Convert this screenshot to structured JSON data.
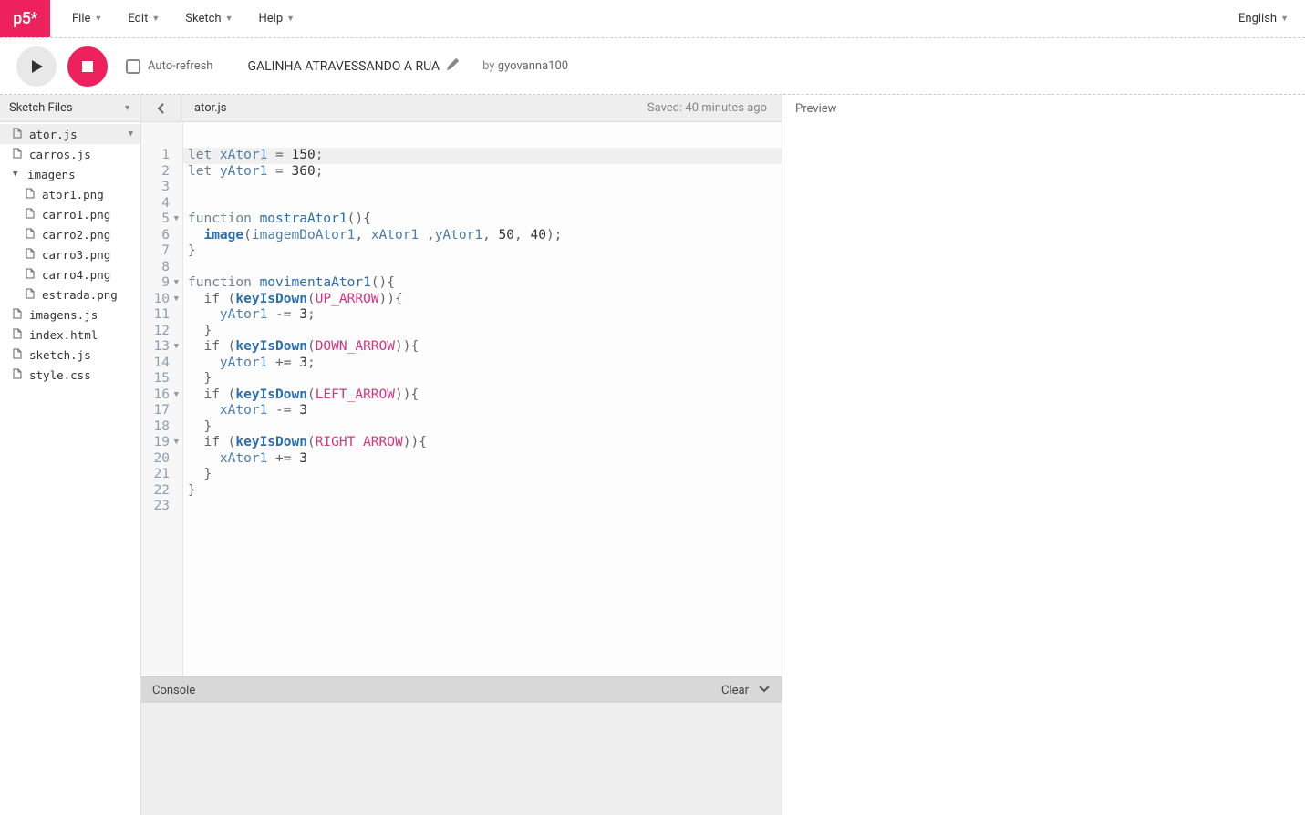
{
  "logo": "p5*",
  "menus": {
    "file": "File",
    "edit": "Edit",
    "sketch": "Sketch",
    "help": "Help"
  },
  "language": "English",
  "toolbar": {
    "autoRefresh": "Auto-refresh",
    "sketchTitle": "GALINHA ATRAVESSANDO A RUA",
    "byPrefix": "by ",
    "author": "gyovanna100"
  },
  "sidebar": {
    "header": "Sketch Files",
    "files": [
      {
        "name": "ator.js",
        "type": "file",
        "indent": 0,
        "active": true
      },
      {
        "name": "carros.js",
        "type": "file",
        "indent": 0
      },
      {
        "name": "imagens",
        "type": "folder",
        "indent": 0,
        "open": true
      },
      {
        "name": "ator1.png",
        "type": "file",
        "indent": 1
      },
      {
        "name": "carro1.png",
        "type": "file",
        "indent": 1
      },
      {
        "name": "carro2.png",
        "type": "file",
        "indent": 1
      },
      {
        "name": "carro3.png",
        "type": "file",
        "indent": 1
      },
      {
        "name": "carro4.png",
        "type": "file",
        "indent": 1
      },
      {
        "name": "estrada.png",
        "type": "file",
        "indent": 1
      },
      {
        "name": "imagens.js",
        "type": "file",
        "indent": 0
      },
      {
        "name": "index.html",
        "type": "file",
        "indent": 0
      },
      {
        "name": "sketch.js",
        "type": "file",
        "indent": 0
      },
      {
        "name": "style.css",
        "type": "file",
        "indent": 0
      }
    ]
  },
  "editor": {
    "tab": "ator.js",
    "saved": "Saved: 40 minutes ago",
    "foldLines": [
      5,
      9,
      10,
      13,
      16,
      19
    ],
    "lineCount": 23,
    "highlightedLine": 1,
    "code": [
      [
        [
          "kw2",
          "let "
        ],
        [
          "var",
          "xAtor1"
        ],
        [
          "punct",
          " = "
        ],
        [
          "num",
          "150"
        ],
        [
          "punct",
          ";"
        ]
      ],
      [
        [
          "kw2",
          "let "
        ],
        [
          "var",
          "yAtor1"
        ],
        [
          "punct",
          " = "
        ],
        [
          "num",
          "360"
        ],
        [
          "punct",
          ";"
        ]
      ],
      [],
      [],
      [
        [
          "kw2",
          "function "
        ],
        [
          "func",
          "mostraAtor1"
        ],
        [
          "punct",
          "(){"
        ]
      ],
      [
        [
          "punct",
          "  "
        ],
        [
          "image",
          "image"
        ],
        [
          "punct",
          "("
        ],
        [
          "var",
          "imagemDoAtor1"
        ],
        [
          "punct",
          ", "
        ],
        [
          "var",
          "xAtor1"
        ],
        [
          "punct",
          " ,"
        ],
        [
          "var",
          "yAtor1"
        ],
        [
          "punct",
          ", "
        ],
        [
          "num",
          "50"
        ],
        [
          "punct",
          ", "
        ],
        [
          "num",
          "40"
        ],
        [
          "punct",
          ");"
        ]
      ],
      [
        [
          "punct",
          "}"
        ]
      ],
      [],
      [
        [
          "kw2",
          "function "
        ],
        [
          "func",
          "movimentaAtor1"
        ],
        [
          "punct",
          "(){"
        ]
      ],
      [
        [
          "punct",
          "  if ("
        ],
        [
          "builtin",
          "keyIsDown"
        ],
        [
          "punct",
          "("
        ],
        [
          "const",
          "UP_ARROW"
        ],
        [
          "punct",
          ")){"
        ]
      ],
      [
        [
          "punct",
          "    "
        ],
        [
          "var",
          "yAtor1"
        ],
        [
          "punct",
          " -= "
        ],
        [
          "num",
          "3"
        ],
        [
          "punct",
          ";"
        ]
      ],
      [
        [
          "punct",
          "  }"
        ]
      ],
      [
        [
          "punct",
          "  if ("
        ],
        [
          "builtin",
          "keyIsDown"
        ],
        [
          "punct",
          "("
        ],
        [
          "const",
          "DOWN_ARROW"
        ],
        [
          "punct",
          ")){"
        ]
      ],
      [
        [
          "punct",
          "    "
        ],
        [
          "var",
          "yAtor1"
        ],
        [
          "punct",
          " += "
        ],
        [
          "num",
          "3"
        ],
        [
          "punct",
          ";"
        ]
      ],
      [
        [
          "punct",
          "  }"
        ]
      ],
      [
        [
          "punct",
          "  if ("
        ],
        [
          "builtin",
          "keyIsDown"
        ],
        [
          "punct",
          "("
        ],
        [
          "const",
          "LEFT_ARROW"
        ],
        [
          "punct",
          ")){"
        ]
      ],
      [
        [
          "punct",
          "    "
        ],
        [
          "var",
          "xAtor1"
        ],
        [
          "punct",
          " -= "
        ],
        [
          "num",
          "3"
        ]
      ],
      [
        [
          "punct",
          "  }"
        ]
      ],
      [
        [
          "punct",
          "  if ("
        ],
        [
          "builtin",
          "keyIsDown"
        ],
        [
          "punct",
          "("
        ],
        [
          "const",
          "RIGHT_ARROW"
        ],
        [
          "punct",
          ")){"
        ]
      ],
      [
        [
          "punct",
          "    "
        ],
        [
          "var",
          "xAtor1"
        ],
        [
          "punct",
          " += "
        ],
        [
          "num",
          "3"
        ]
      ],
      [
        [
          "punct",
          "  }"
        ]
      ],
      [
        [
          "punct",
          "}"
        ]
      ],
      []
    ]
  },
  "console": {
    "title": "Console",
    "clear": "Clear"
  },
  "preview": {
    "title": "Preview"
  }
}
